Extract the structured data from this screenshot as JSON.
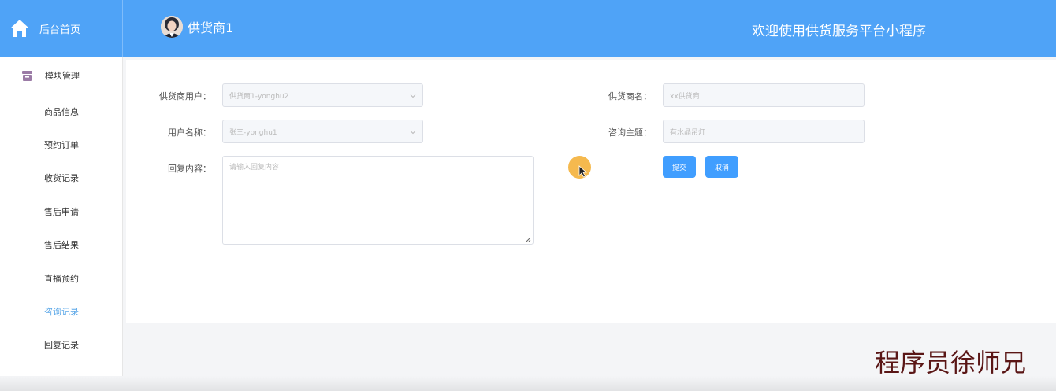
{
  "header": {
    "home_label": "后台首页",
    "user_name": "供货商1",
    "welcome": "欢迎使用供货服务平台小程序"
  },
  "sidebar": {
    "module_label": "模块管理",
    "items": [
      {
        "label": "商品信息"
      },
      {
        "label": "预约订单"
      },
      {
        "label": "收货记录"
      },
      {
        "label": "售后申请"
      },
      {
        "label": "售后结果"
      },
      {
        "label": "直播预约"
      },
      {
        "label": "咨询记录",
        "active": true
      },
      {
        "label": "回复记录"
      }
    ]
  },
  "form": {
    "supplier_user_label": "供货商用户：",
    "supplier_user_value": "供货商1-yonghu2",
    "username_label": "用户名称：",
    "username_value": "张三-yonghu1",
    "reply_label": "回复内容：",
    "reply_placeholder": "请输入回复内容",
    "supplier_name_label": "供货商名：",
    "supplier_name_value": "xx供货商",
    "subject_label": "咨询主题：",
    "subject_value": "有水晶吊灯",
    "submit_label": "提交",
    "cancel_label": "取消"
  },
  "watermark": "程序员徐师兄",
  "colors": {
    "header_bg": "#4fa3f7",
    "primary_button": "#409eff",
    "active_nav": "#5ca8e8"
  }
}
